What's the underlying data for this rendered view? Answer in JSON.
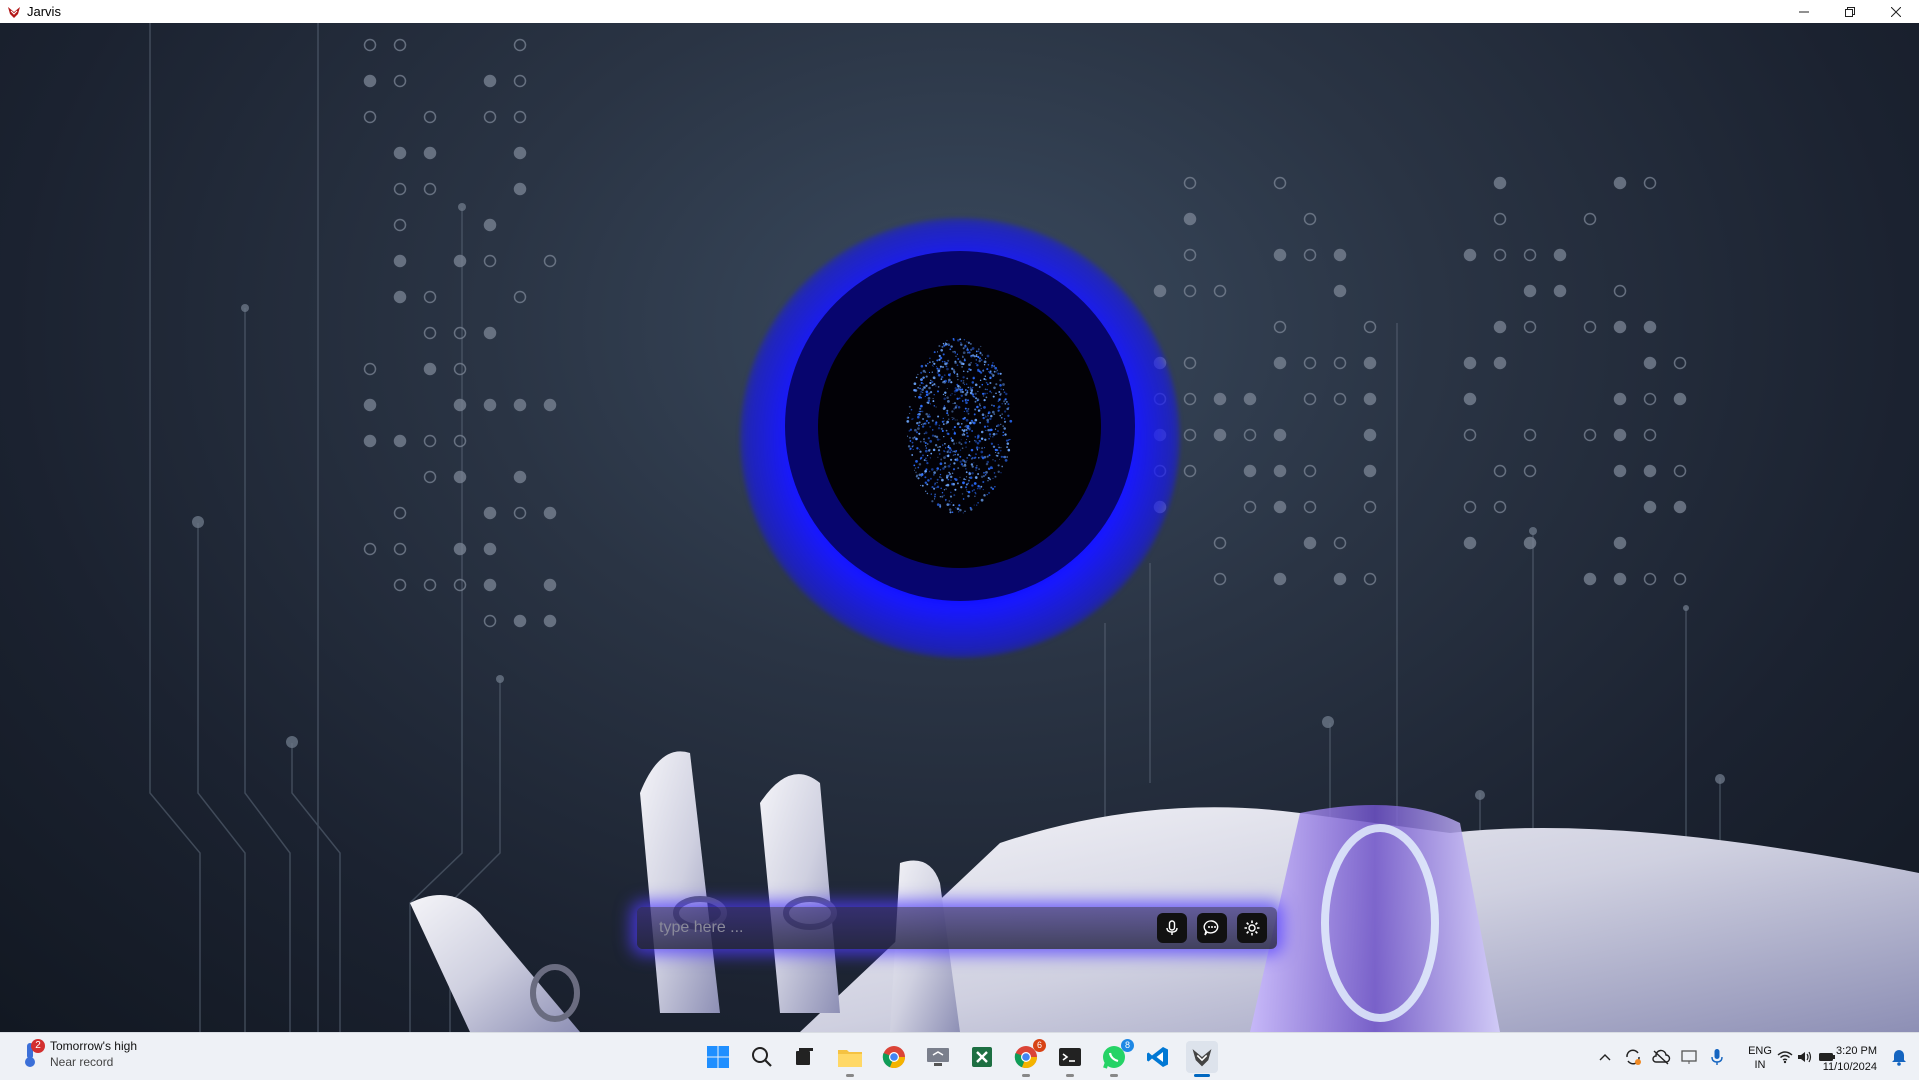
{
  "window": {
    "title": "Jarvis"
  },
  "input": {
    "placeholder": "type here ..."
  },
  "weather": {
    "badge_count": "2",
    "line1": "Tomorrow's high",
    "line2": "Near record"
  },
  "taskbar": {
    "whatsapp_badge": "8",
    "chrome2_badge": "6"
  },
  "tray": {
    "lang_top": "ENG",
    "lang_bottom": "IN",
    "time": "3:20 PM",
    "date": "11/10/2024"
  },
  "colors": {
    "orb_glow": "#0000ff",
    "accent": "#0067c0",
    "taskbar_bg": "#eef1f6"
  }
}
